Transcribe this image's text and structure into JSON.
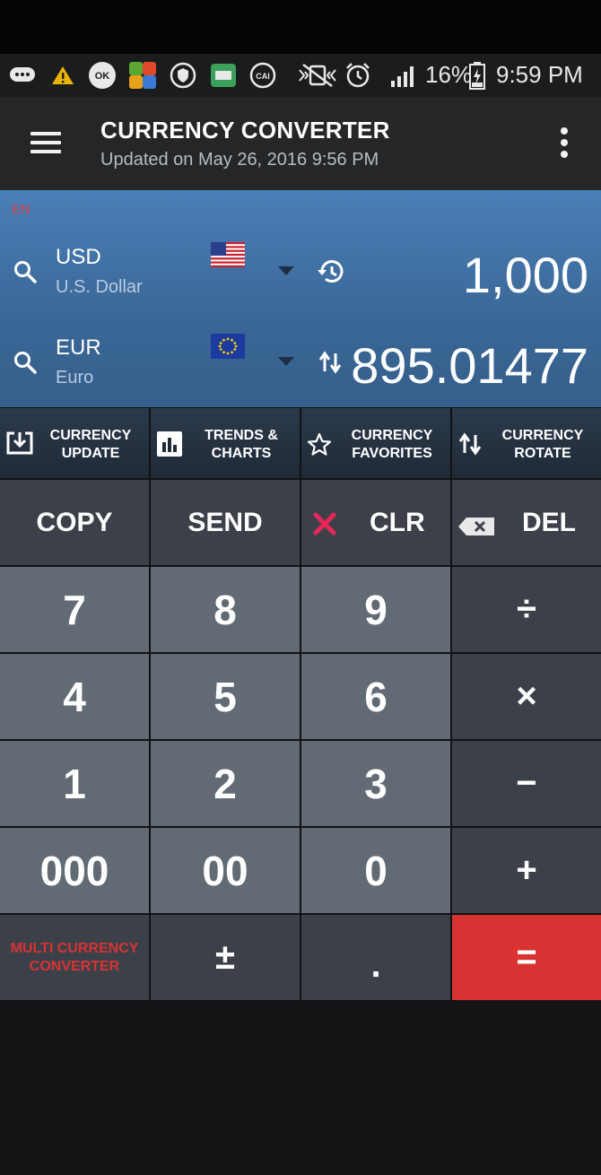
{
  "status_bar": {
    "battery_pct": "16%",
    "time": "9:59 PM",
    "icons": [
      "messages-icon",
      "warning-icon",
      "ok-app-icon",
      "money-app-icon",
      "vpn-shield-icon",
      "keyboard-icon",
      "cai-app-icon",
      "vibrate-icon",
      "alarm-icon",
      "signal-icon",
      "battery-icon"
    ]
  },
  "app_bar": {
    "title": "CURRENCY CONVERTER",
    "subtitle": "Updated on May 26, 2016 9:56 PM"
  },
  "converter": {
    "lang": "EN",
    "from": {
      "code": "USD",
      "name": "U.S. Dollar",
      "amount": "1,000",
      "flag": "us-flag"
    },
    "to": {
      "code": "EUR",
      "name": "Euro",
      "amount": "895.01477",
      "flag": "eu-flag"
    }
  },
  "actions": [
    {
      "line1": "CURRENCY",
      "line2": "UPDATE",
      "icon": "download-icon"
    },
    {
      "line1": "TRENDS &",
      "line2": "CHARTS",
      "icon": "bar-chart-icon"
    },
    {
      "line1": "CURRENCY",
      "line2": "FAVORITES",
      "icon": "star-icon"
    },
    {
      "line1": "CURRENCY",
      "line2": "ROTATE",
      "icon": "swap-icon"
    }
  ],
  "keypad": {
    "copy": "COPY",
    "send": "SEND",
    "clr": "CLR",
    "del": "DEL",
    "r1": [
      "7",
      "8",
      "9",
      "÷"
    ],
    "r2": [
      "4",
      "5",
      "6",
      "×"
    ],
    "r3": [
      "1",
      "2",
      "3",
      "−"
    ],
    "r4": [
      "000",
      "00",
      "0",
      "+"
    ],
    "multi_line1": "MULTI CURRENCY",
    "multi_line2": "CONVERTER",
    "plusminus": "±",
    "decimal": ".",
    "equals": "="
  },
  "colors": {
    "accent_red": "#d93232",
    "panel_blue": "#3a6796",
    "clr_x": "#e8265a"
  }
}
